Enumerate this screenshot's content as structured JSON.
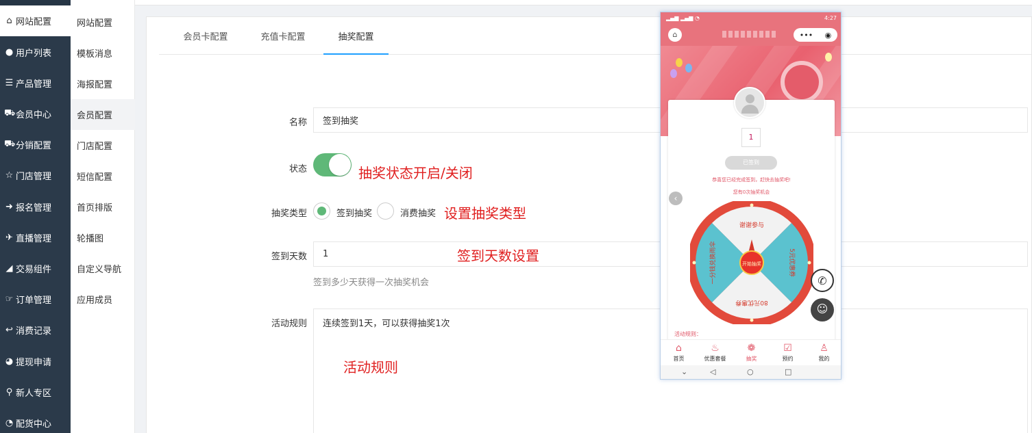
{
  "sidebar": {
    "items": [
      {
        "icon": "home-icon",
        "glyph": "⌂",
        "label": "网站配置"
      },
      {
        "icon": "user-icon",
        "glyph": "●",
        "label": "用户列表"
      },
      {
        "icon": "product-icon",
        "glyph": "☰",
        "label": "产品管理"
      },
      {
        "icon": "cart-icon",
        "glyph": "⛟",
        "label": "会员中心"
      },
      {
        "icon": "cart-icon",
        "glyph": "⛟",
        "label": "分销配置"
      },
      {
        "icon": "star-icon",
        "glyph": "☆",
        "label": "门店管理"
      },
      {
        "icon": "signup-icon",
        "glyph": "➜",
        "label": "报名管理"
      },
      {
        "icon": "plane-icon",
        "glyph": "✈",
        "label": "直播管理"
      },
      {
        "icon": "eraser-icon",
        "glyph": "◢",
        "label": "交易组件"
      },
      {
        "icon": "hand-icon",
        "glyph": "☞",
        "label": "订单管理"
      },
      {
        "icon": "reply-icon",
        "glyph": "↩",
        "label": "消费记录"
      },
      {
        "icon": "wechat-icon",
        "glyph": "◕",
        "label": "提现申请"
      },
      {
        "icon": "pin-icon",
        "glyph": "⚲",
        "label": "新人专区"
      },
      {
        "icon": "pie-icon",
        "glyph": "◔",
        "label": "配货中心"
      }
    ]
  },
  "submenu": {
    "items": [
      "网站配置",
      "模板消息",
      "海报配置",
      "会员配置",
      "门店配置",
      "短信配置",
      "首页排版",
      "轮播图",
      "自定义导航",
      "应用成员"
    ]
  },
  "tabs": [
    "会员卡配置",
    "充值卡配置",
    "抽奖配置"
  ],
  "form": {
    "name_label": "名称",
    "name_value": "签到抽奖",
    "status_label": "状态",
    "type_label": "抽奖类型",
    "type_option_1": "签到抽奖",
    "type_option_2": "消费抽奖",
    "days_label": "签到天数",
    "days_value": "1",
    "days_hint": "签到多少天获得一次抽奖机会",
    "rules_label": "活动规则",
    "rules_value": "连续签到1天，可以获得抽奖1次"
  },
  "annotations": {
    "status_note": "抽奖状态开启/关闭",
    "type_note": "设置抽奖类型",
    "days_note": "签到天数设置",
    "rules_note": "活动规则"
  },
  "phone": {
    "clock": "4:27",
    "calendar_number": "1",
    "signed_button": "已签到",
    "congrats_text": "恭喜您已经完成签到，赶快去抽奖吧!",
    "chances_text": "您有0次抽奖机会",
    "wheel": {
      "center_label": "开始抽奖",
      "prizes": [
        "谢谢参与",
        "5元优惠券",
        "80元优惠券",
        "一分钱兑换雨伞"
      ]
    },
    "rules_label": "活动规则：",
    "tabbar": [
      "首页",
      "优惠套餐",
      "抽奖",
      "预约",
      "我的"
    ],
    "active_tab": "抽奖"
  },
  "colors": {
    "sidebar_bg": "#2b3a4a",
    "accent_green": "#5fb878",
    "tab_active": "#1e9fff",
    "note_red": "#e02020",
    "phone_pink": "#e8737d",
    "wheel_red": "#e24a3b",
    "wheel_teal": "#5bc2cf"
  }
}
